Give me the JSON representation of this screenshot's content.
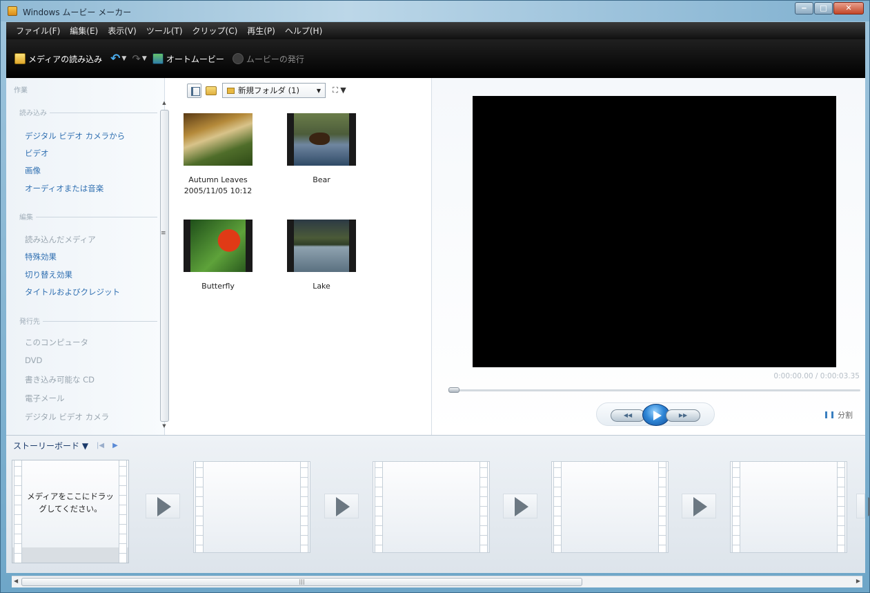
{
  "window": {
    "title": "Windows ムービー メーカー",
    "buttons": {
      "minimize": "‒",
      "maximize": "□",
      "close": "✕"
    }
  },
  "menu": [
    "ファイル(F)",
    "編集(E)",
    "表示(V)",
    "ツール(T)",
    "クリップ(C)",
    "再生(P)",
    "ヘルプ(H)"
  ],
  "toolbar": {
    "import": "メディアの読み込み",
    "undo_icon": "undo-icon",
    "redo_icon": "redo-icon",
    "automovie": "オートムービー",
    "publish": "ムービーの発行"
  },
  "tasks": {
    "title": "作業",
    "sections": [
      {
        "heading": "読み込み",
        "items": [
          "デジタル ビデオ カメラから",
          "ビデオ",
          "画像",
          "オーディオまたは音楽"
        ]
      },
      {
        "heading": "編集",
        "items": [
          "読み込んだメディア",
          "特殊効果",
          "切り替え効果",
          "タイトルおよびクレジット"
        ]
      },
      {
        "heading": "発行先",
        "items": [
          "このコンピュータ",
          "DVD",
          "書き込み可能な CD",
          "電子メール",
          "デジタル ビデオ カメラ"
        ]
      }
    ]
  },
  "collection": {
    "folder": "新規フォルダ (1)",
    "clips": [
      {
        "name": "Autumn Leaves",
        "date": "2005/11/05 10:12",
        "kind": "photo"
      },
      {
        "name": "Bear",
        "date": "",
        "kind": "video"
      },
      {
        "name": "Butterfly",
        "date": "",
        "kind": "video"
      },
      {
        "name": "Lake",
        "date": "",
        "kind": "video"
      }
    ]
  },
  "preview": {
    "time": "0:00:00.00 / 0:00:03.35",
    "seek_position": 0,
    "split_label": "分割"
  },
  "storyboard": {
    "label": "ストーリーボード ▼",
    "drop_hint": "メディアをここにドラッグしてください。"
  },
  "colors": {
    "menubar": "#101010",
    "link": "#2f6fb1",
    "play_button": "#2f86d6"
  }
}
